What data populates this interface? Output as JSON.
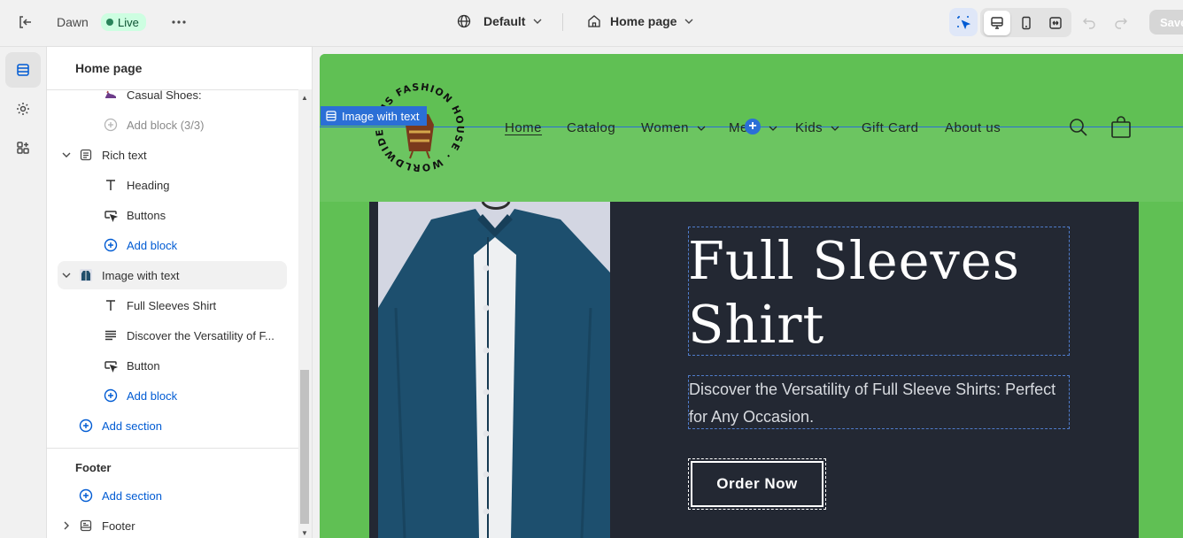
{
  "topbar": {
    "theme_name": "Dawn",
    "live_label": "Live",
    "template_dropdown": "Default",
    "page_dropdown": "Home page",
    "save_label": "Save"
  },
  "sidebar": {
    "title": "Home page",
    "items": {
      "casual_shoes": "Casual Shoes:",
      "add_block_limit": "Add block (3/3)",
      "rich_text": "Rich text",
      "heading": "Heading",
      "buttons": "Buttons",
      "add_block_1": "Add block",
      "image_with_text": "Image with text",
      "full_sleeves": "Full Sleeves Shirt",
      "discover": "Discover the Versatility of F...",
      "button": "Button",
      "add_block_2": "Add block",
      "add_section_1": "Add section",
      "footer_group": "Footer",
      "add_section_2": "Add section",
      "footer": "Footer"
    }
  },
  "preview": {
    "selection_label": "Image with text",
    "logo_text": "EMS FASHION HOUSE · WORLDWIDE",
    "nav": {
      "home": "Home",
      "catalog": "Catalog",
      "women": "Women",
      "men": "Me",
      "kids": "Kids",
      "gift_card": "Gift Card",
      "about": "About us"
    },
    "heading": "Full Sleeves Shirt",
    "text": "Discover the Versatility of Full Sleeve Shirts: Perfect for Any Occasion.",
    "button": "Order Now"
  },
  "colors": {
    "header_bg": "#60c054",
    "panel_bg": "#232833",
    "selection_blue": "#2b6fd6",
    "link_blue": "#005bd3"
  }
}
